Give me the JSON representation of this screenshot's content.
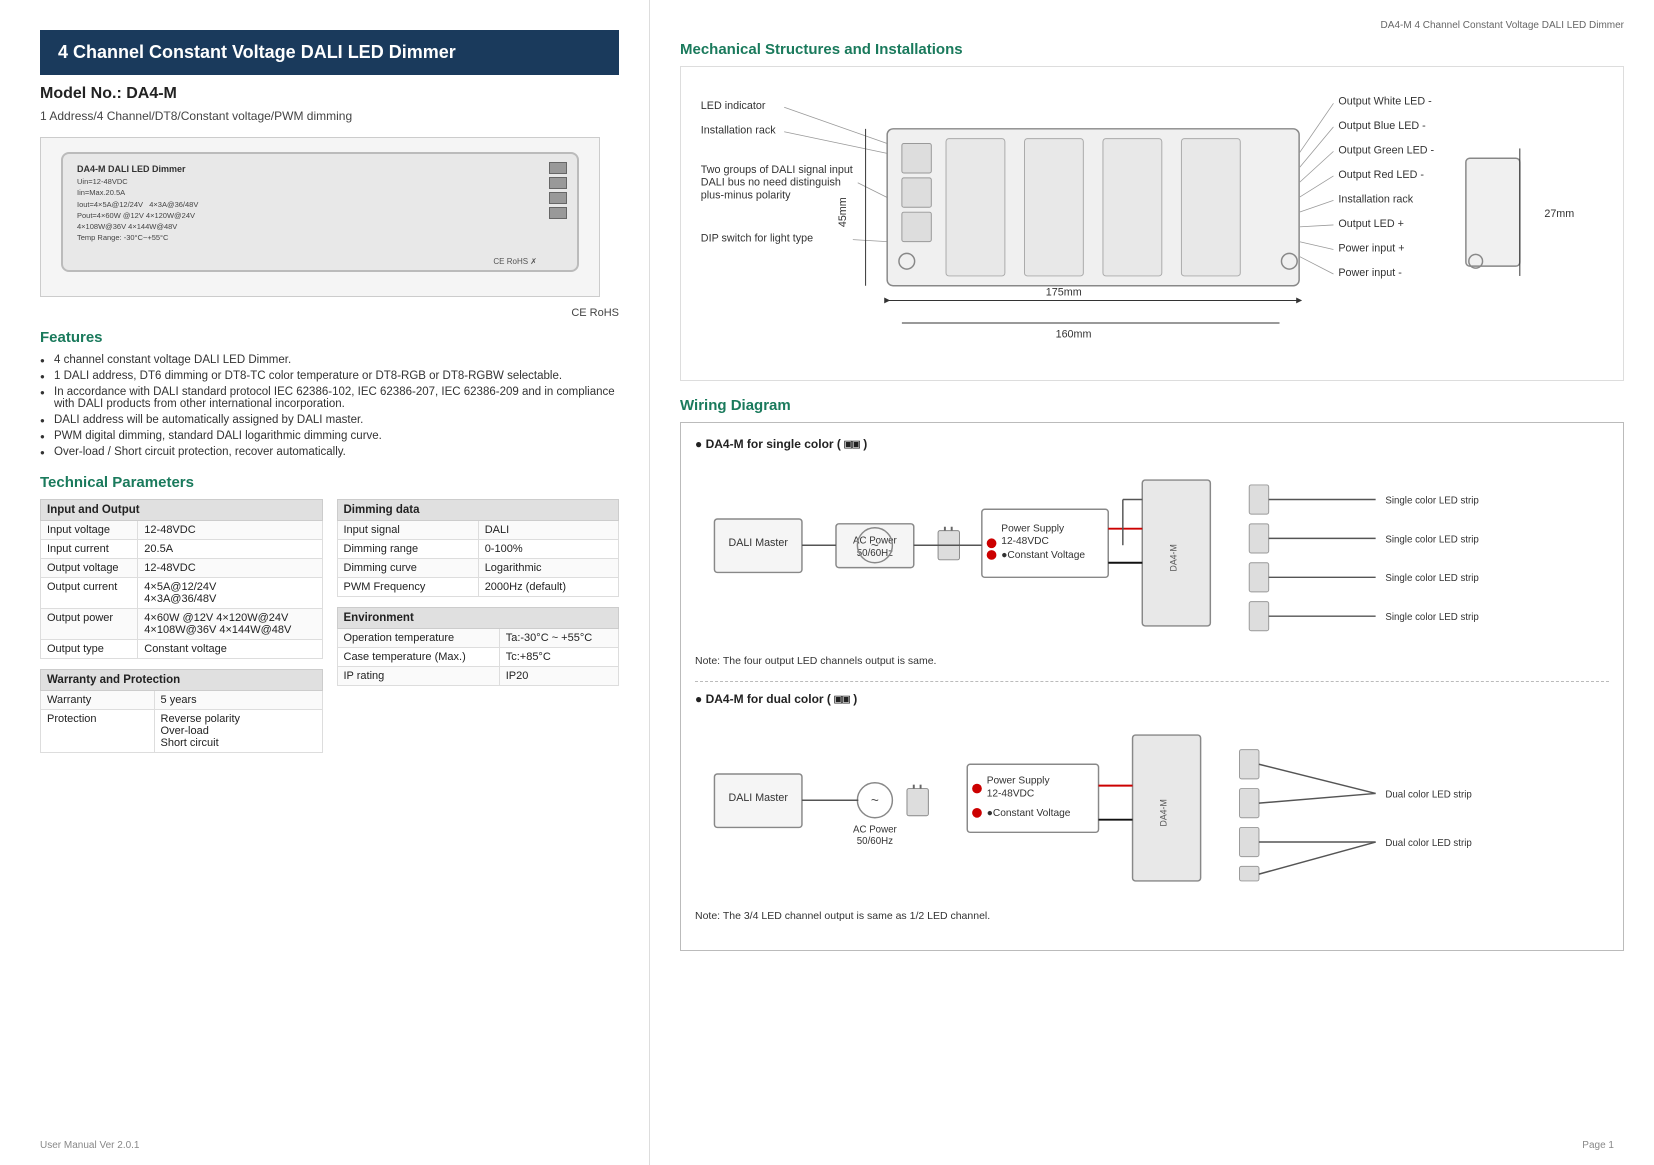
{
  "page": {
    "header_right": "DA4-M  4 Channel Constant Voltage DALI LED Dimmer",
    "footer_left": "User Manual Ver 2.0.1",
    "footer_right": "Page 1"
  },
  "left": {
    "title_bar": "4 Channel Constant Voltage DALI LED Dimmer",
    "model_no": "Model No.: DA4-M",
    "subtitle": "1 Address/4 Channel/DT8/Constant voltage/PWM dimming",
    "device_label": "DA4-M DALI LED Dimmer",
    "device_specs": [
      "Uin=12-48VDC",
      "Iin=Max.20.5A",
      "Iout=4×5A@12/24V",
      "4×3A@36/48V",
      "Pout=4×60W @12V 4×120W@24V",
      "4×108W@36V 4×144W@48V",
      "Temp Range: -30°C~+55°C"
    ],
    "ce_rohs": "CE  RoHS",
    "features_title": "Features",
    "features": [
      "4 channel constant voltage DALI LED Dimmer.",
      "1 DALI address, DT6 dimming or DT8-TC color temperature or DT8-RGB or DT8-RGBW selectable.",
      "In accordance with DALI standard protocol IEC 62386-102, IEC 62386-207, IEC 62386-209 and in compliance with DALI products from other international incorporation.",
      "DALI address will be automatically assigned by DALI master.",
      "PWM digital dimming, standard DALI logarithmic dimming curve.",
      "Over-load / Short circuit protection, recover automatically."
    ],
    "tech_params_title": "Technical Parameters",
    "table_io_header": "Input and Output",
    "table_io_rows": [
      [
        "Input voltage",
        "12-48VDC"
      ],
      [
        "Input current",
        "20.5A"
      ],
      [
        "Output voltage",
        "12-48VDC"
      ],
      [
        "Output current",
        "4×5A@12/24V\n4×3A@36/48V"
      ],
      [
        "Output power",
        "4×60W @12V 4×120W@24V\n4×108W@36V 4×144W@48V"
      ],
      [
        "Output type",
        "Constant voltage"
      ]
    ],
    "table_warranty_header": "Warranty and Protection",
    "table_warranty_rows": [
      [
        "Warranty",
        "5 years"
      ],
      [
        "Protection",
        "Reverse polarity\nOver-load\nShort circuit"
      ]
    ],
    "table_dimming_header": "Dimming data",
    "table_dimming_rows": [
      [
        "Input signal",
        "DALI"
      ],
      [
        "Dimming range",
        "0-100%"
      ],
      [
        "Dimming curve",
        "Logarithmic"
      ],
      [
        "PWM Frequency",
        "2000Hz (default)"
      ]
    ],
    "table_env_header": "Environment",
    "table_env_rows": [
      [
        "Operation temperature",
        "Ta:-30°C ~ +55°C"
      ],
      [
        "Case temperature (Max.)",
        "Tc:+85°C"
      ],
      [
        "IP rating",
        "IP20"
      ]
    ]
  },
  "right": {
    "mech_title": "Mechanical Structures and Installations",
    "mech_labels": {
      "led_indicator": "LED indicator",
      "installation_rack": "Installation rack",
      "dali_signal": "Two groups of DALI signal input DALI bus no need distinguish plus-minus polarity",
      "dip_switch": "DIP switch for light type",
      "output_white": "Output White LED -",
      "output_blue": "Output Blue LED -",
      "output_green": "Output Green LED -",
      "output_red": "Output Red LED -",
      "installation_rack_r": "Installation rack",
      "output_led_plus": "Output LED +",
      "power_plus": "Power input +",
      "power_minus": "Power input -",
      "dim_175": "175mm",
      "dim_160": "160mm",
      "dim_45": "45mm",
      "dim_27": "27mm"
    },
    "wiring_title": "Wiring Diagram",
    "wiring_single_label": "● DA4-M for single color (",
    "wiring_single_icon": "▣▣",
    "wiring_single_note": "Note: The four output LED channels output is same.",
    "wiring_dual_label": "● DA4-M for dual color (",
    "wiring_dual_icon": "▣▣",
    "wiring_dual_note": "Note: The 3/4 LED channel output is same as 1/2 LED channel.",
    "led_strips_single": [
      "Single color LED strip",
      "Single color LED strip",
      "Single color LED strip",
      "Single color LED strip"
    ],
    "led_strips_dual": [
      "Dual color LED strip",
      "Dual color LED strip"
    ],
    "power_supply_label": "Power Supply\n12-48VDC\n●Constant Voltage",
    "dali_master_label": "DALI Master",
    "ac_power_label": "AC Power\n50/60Hz"
  }
}
